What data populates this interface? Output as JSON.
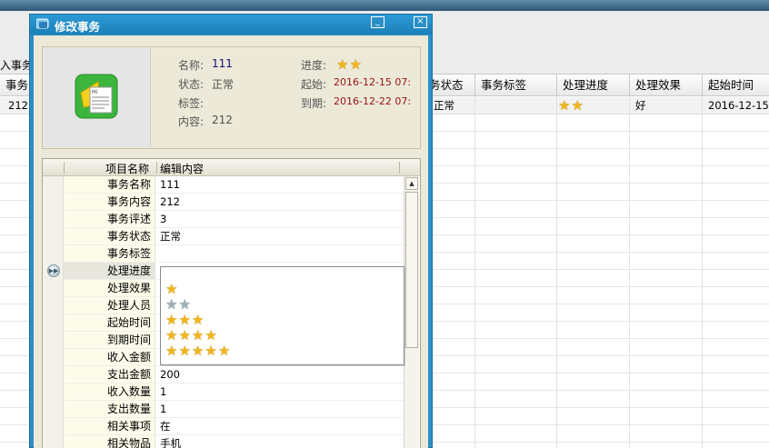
{
  "background_app": {
    "toolbar_import_label": "入事务",
    "grid_columns": [
      "事务",
      "务状态",
      "事务标签",
      "处理进度",
      "处理效果",
      "起始时间"
    ],
    "grid_row": {
      "col0": "212",
      "status": "正常",
      "progress_stars": 2,
      "effect": "好",
      "start": "2016-12-15"
    }
  },
  "dialog": {
    "title": "修改事务",
    "minimize_glyph": "_",
    "close_glyph": "×",
    "info": {
      "name_label": "名称:",
      "name_value": "111",
      "status_label": "状态:",
      "status_value": "正常",
      "tags_label": "标签:",
      "tags_value": "",
      "content_label": "内容:",
      "content_value": "212",
      "progress_label": "进度:",
      "progress_stars": 2,
      "start_label": "起始:",
      "start_value": "2016-12-15 07:",
      "due_label": "到期:",
      "due_value": "2016-12-22 07:"
    },
    "property_grid": {
      "header_name": "项目名称",
      "header_value": "编辑内容",
      "rows": [
        {
          "name": "事务名称",
          "value": "111"
        },
        {
          "name": "事务内容",
          "value": "212"
        },
        {
          "name": "事务评述",
          "value": "3"
        },
        {
          "name": "事务状态",
          "value": "正常"
        },
        {
          "name": "事务标签",
          "value": ""
        },
        {
          "name": "处理进度",
          "value": ""
        },
        {
          "name": "处理效果",
          "value": ""
        },
        {
          "name": "处理人员",
          "value": ""
        },
        {
          "name": "起始时间",
          "value": ""
        },
        {
          "name": "到期时间",
          "value": ""
        },
        {
          "name": "收入金额",
          "value": ""
        },
        {
          "name": "支出金额",
          "value": "200"
        },
        {
          "name": "收入数量",
          "value": "1"
        },
        {
          "name": "支出数量",
          "value": "1"
        },
        {
          "name": "相关事项",
          "value": "在"
        },
        {
          "name": "相关物品",
          "value": "手机"
        }
      ],
      "selected_row": 5,
      "dropdown_options": [
        {
          "stars": 1,
          "style": "gold"
        },
        {
          "stars": 2,
          "style": "silver"
        },
        {
          "stars": 3,
          "style": "gold"
        },
        {
          "stars": 4,
          "style": "gold"
        },
        {
          "stars": 5,
          "style": "gold"
        }
      ]
    }
  },
  "colors": {
    "dialog_frame": "#2a8fc7",
    "panel_bg": "#ece9d8",
    "star_gold": "#f1b51c",
    "star_silver": "#9fb0b8",
    "date_red": "#9b1111"
  }
}
